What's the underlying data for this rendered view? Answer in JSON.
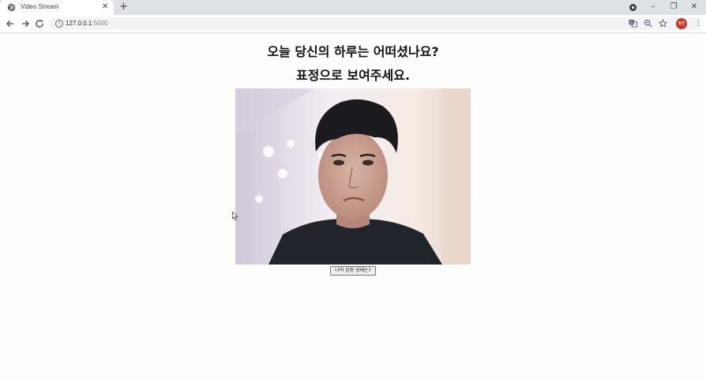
{
  "browser": {
    "tab_title": "Video Stream",
    "tab_close_glyph": "✕",
    "new_tab_glyph": "+",
    "url_host": "127.0.0.1",
    "url_port": ":5000",
    "profile_initials": "정민",
    "window_controls": {
      "minimize": "–",
      "restore": "❐",
      "close": "✕"
    }
  },
  "page": {
    "heading_line1": "오늘 당신의 하루는 어떠셨나요?",
    "heading_line2": "표정으로 보여주세요.",
    "emotion_button_label": "나의 감정 상태는?"
  },
  "colors": {
    "tabstrip": "#dee1e6",
    "avatar": "#c0392b"
  },
  "icons": [
    "globe-icon",
    "back-arrow-icon",
    "forward-arrow-icon",
    "reload-icon",
    "info-icon",
    "translate-icon",
    "zoom-icon",
    "star-icon",
    "menu-icon"
  ]
}
